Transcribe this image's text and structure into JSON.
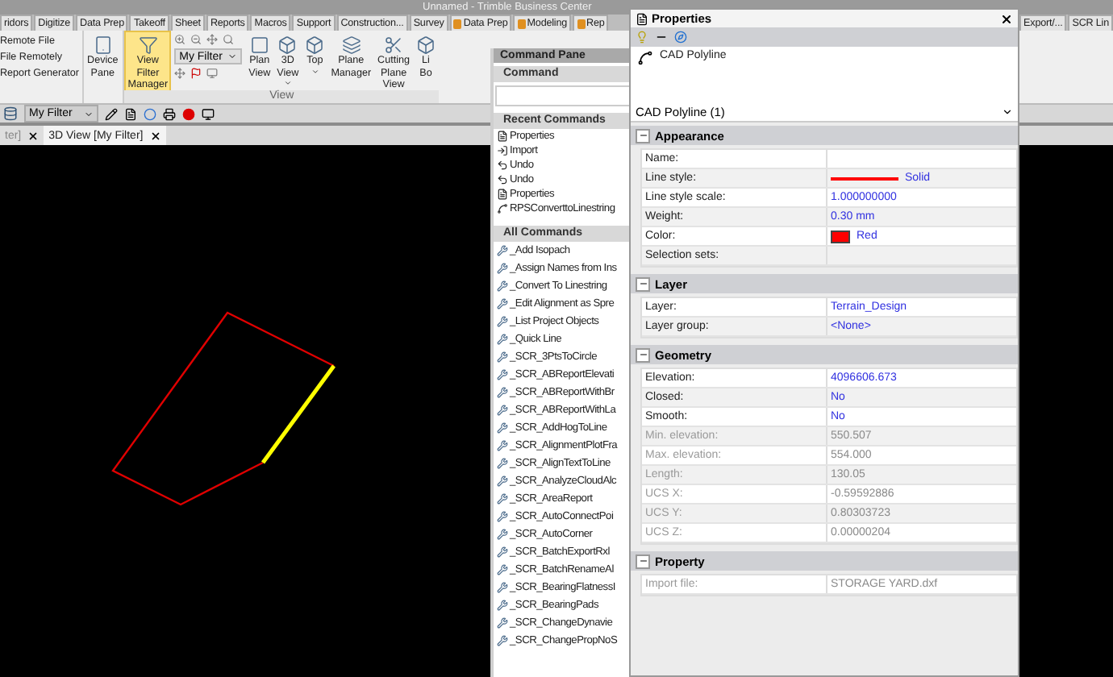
{
  "window": {
    "title": "Unnamed - Trimble Business Center"
  },
  "ribbon_tabs": [
    {
      "label": "ridors",
      "selected": false,
      "kind": "plain"
    },
    {
      "label": "Digitize",
      "selected": false,
      "kind": "plain"
    },
    {
      "label": "Data Prep",
      "selected": false,
      "kind": "plain"
    },
    {
      "label": "Takeoff",
      "selected": false,
      "kind": "plain"
    },
    {
      "label": "Sheet",
      "selected": false,
      "kind": "plain"
    },
    {
      "label": "Reports",
      "selected": false,
      "kind": "plain"
    },
    {
      "label": "Macros",
      "selected": false,
      "kind": "plain"
    },
    {
      "label": "Support",
      "selected": false,
      "kind": "plain"
    },
    {
      "label": "Construction...",
      "selected": false,
      "kind": "plain"
    },
    {
      "label": "Survey",
      "selected": false,
      "kind": "plain"
    },
    {
      "label": "Data Prep",
      "selected": false,
      "kind": "macro"
    },
    {
      "label": "Modeling",
      "selected": false,
      "kind": "macro"
    },
    {
      "label": "Rep",
      "selected": false,
      "kind": "macro"
    }
  ],
  "side_tabs": [
    {
      "label": "Export/...",
      "selected": false
    },
    {
      "label": "SCR Lin",
      "selected": false
    }
  ],
  "ribbon": {
    "file_commands": [
      "Remote File",
      "File Remotely",
      "Report Generator"
    ],
    "buttons": [
      {
        "label": "Device Pane",
        "kind": "device",
        "selected": false
      },
      {
        "label": "View Filter Manager",
        "kind": "filter",
        "selected": true
      }
    ],
    "filter_dropdown": "My Filter",
    "view_buttons": [
      {
        "label": "Plan View",
        "kind": "plan",
        "dropdown": false
      },
      {
        "label": "3D View",
        "kind": "cube3d",
        "dropdown": true
      },
      {
        "label": "Top",
        "kind": "top",
        "dropdown": true
      },
      {
        "label": "Plane Manager",
        "kind": "plane",
        "dropdown": false
      },
      {
        "label": "Cutting Plane View",
        "kind": "cut",
        "dropdown": false
      },
      {
        "label": "Li Bo",
        "kind": "box",
        "dropdown": false
      }
    ],
    "group_label": "View"
  },
  "toolbar": {
    "filter": "My Filter"
  },
  "doc_tabs": [
    {
      "label": "ter]",
      "selected": false
    },
    {
      "label": "3D View [My Filter]",
      "selected": true
    }
  ],
  "command_pane": {
    "title": "Command Pane",
    "command_header": "Command",
    "recent_header": "Recent Commands",
    "recent": [
      {
        "label": "Properties",
        "kind": "document"
      },
      {
        "label": "Import",
        "kind": "import"
      },
      {
        "label": "Undo",
        "kind": "undo"
      },
      {
        "label": "Undo",
        "kind": "undo"
      },
      {
        "label": "Properties",
        "kind": "document"
      },
      {
        "label": "RPSConverttoLinestring",
        "kind": "line"
      }
    ],
    "all_header": "All Commands",
    "all": [
      "_Add Isopach",
      "_Assign Names from Ins",
      "_Convert To Linestring",
      "_Edit Alignment as Spre",
      "_List Project Objects",
      "_Quick Line",
      "_SCR_3PtsToCircle",
      "_SCR_ABReportElevati",
      "_SCR_ABReportWithBr",
      "_SCR_ABReportWithLa",
      "_SCR_AddHogToLine",
      "_SCR_AlignmentPlotFra",
      "_SCR_AlignTextToLine",
      "_SCR_AnalyzeCloudAlc",
      "_SCR_AreaReport",
      "_SCR_AutoConnectPoi",
      "_SCR_AutoCorner",
      "_SCR_BatchExportRxl",
      "_SCR_BatchRenameAl",
      "_SCR_BearingFlatnessI",
      "_SCR_BearingPads",
      "_SCR_ChangeDynavie",
      "_SCR_ChangePropNoS"
    ]
  },
  "properties": {
    "title": "Properties",
    "object": "CAD Polyline",
    "selector": "CAD Polyline (1)",
    "sections": [
      {
        "title": "Appearance",
        "expanded": true,
        "rows": [
          {
            "label": "Name:",
            "disabled": false,
            "kind": "text"
          },
          {
            "label": "Line style:",
            "value": "Solid",
            "disabled": false,
            "kind": "line",
            "color": "#ff0000"
          },
          {
            "label": "Line style scale:",
            "value": "1.000000000",
            "disabled": false,
            "kind": "text"
          },
          {
            "label": "Weight:",
            "value": "0.30 mm",
            "disabled": false,
            "kind": "text"
          },
          {
            "label": "Color:",
            "value": "Red",
            "disabled": false,
            "kind": "swatch",
            "color": "#ff0000"
          },
          {
            "label": "Selection sets:",
            "disabled": false,
            "kind": "text"
          }
        ]
      },
      {
        "title": "Layer",
        "expanded": true,
        "rows": [
          {
            "label": "Layer:",
            "value": "Terrain_Design",
            "disabled": false,
            "kind": "text"
          },
          {
            "label": "Layer group:",
            "value": "<None>",
            "disabled": false,
            "kind": "text"
          }
        ]
      },
      {
        "title": "Geometry",
        "expanded": true,
        "rows": [
          {
            "label": "Elevation:",
            "value": "4096606.673",
            "disabled": false,
            "kind": "text"
          },
          {
            "label": "Closed:",
            "value": "No",
            "disabled": false,
            "kind": "text"
          },
          {
            "label": "Smooth:",
            "value": "No",
            "disabled": false,
            "kind": "text"
          },
          {
            "label": "Min. elevation:",
            "value": "550.507",
            "disabled": true,
            "kind": "text"
          },
          {
            "label": "Max. elevation:",
            "value": "554.000",
            "disabled": true,
            "kind": "text"
          },
          {
            "label": "Length:",
            "value": "130.05",
            "disabled": true,
            "kind": "text"
          },
          {
            "label": "UCS X:",
            "value": "-0.59592886",
            "disabled": true,
            "kind": "text"
          },
          {
            "label": "UCS Y:",
            "value": "0.80303723",
            "disabled": true,
            "kind": "text"
          },
          {
            "label": "UCS Z:",
            "value": "0.00000204",
            "disabled": true,
            "kind": "text"
          }
        ]
      },
      {
        "title": "Property",
        "expanded": true,
        "rows": [
          {
            "label": "Import file:",
            "value": "STORAGE YARD.dxf",
            "disabled": true,
            "kind": "text"
          }
        ]
      }
    ]
  }
}
